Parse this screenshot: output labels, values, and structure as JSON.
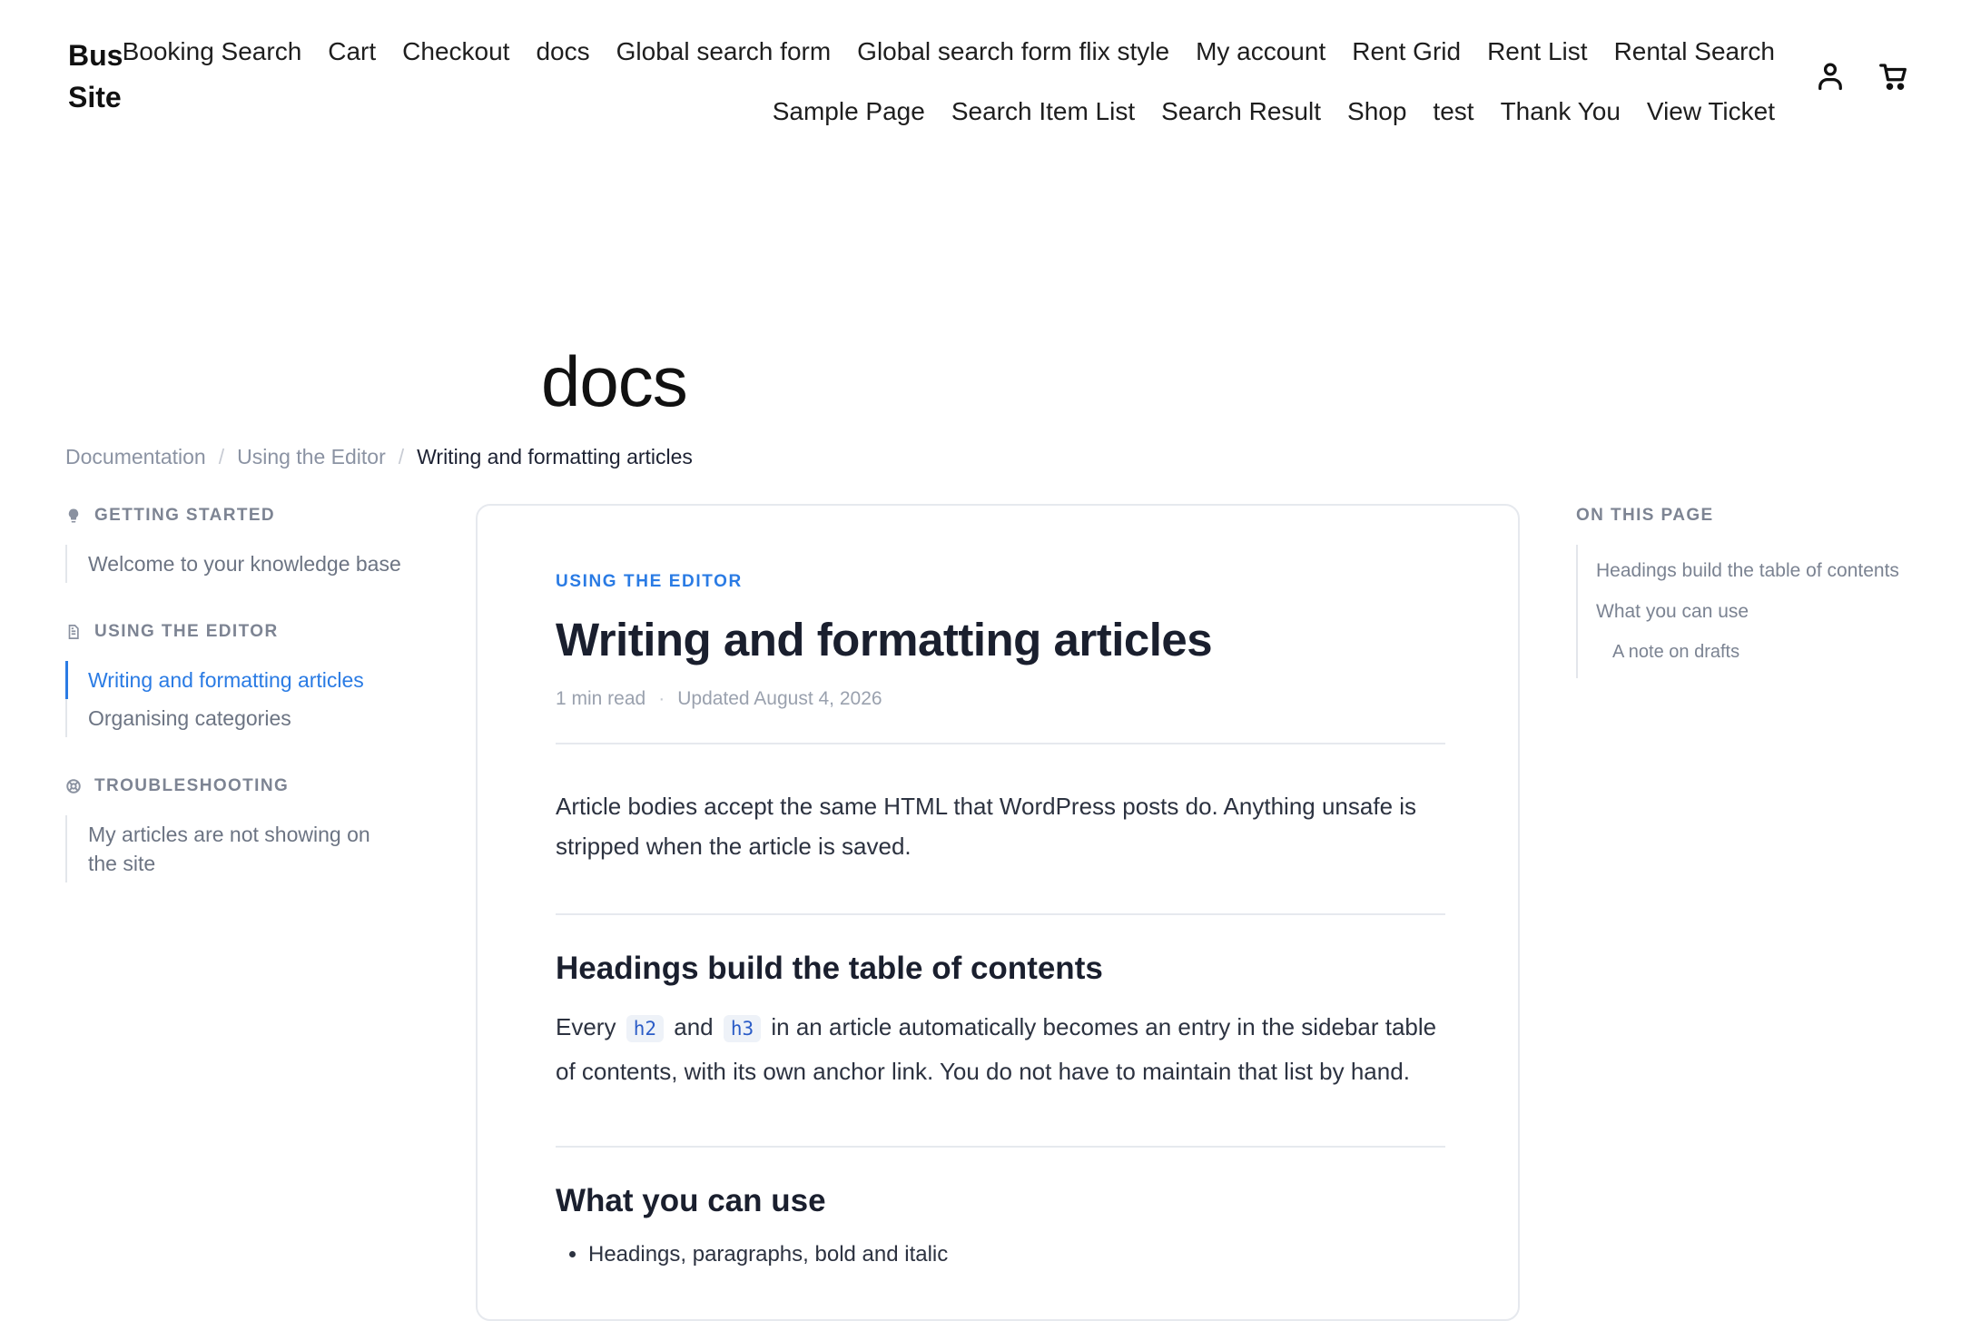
{
  "site": {
    "title": "Bus Site"
  },
  "nav": {
    "row1": [
      "Booking Search",
      "Cart",
      "Checkout",
      "docs",
      "Global search form",
      "Global search form flix style",
      "My account",
      "Rent Grid",
      "Rent List",
      "Rental Search"
    ],
    "row2": [
      "Sample Page",
      "Search Item List",
      "Search Result",
      "Shop",
      "test",
      "Thank You",
      "View Ticket"
    ]
  },
  "icons": {
    "account": "user-icon",
    "cart": "cart-icon"
  },
  "page": {
    "title": "docs"
  },
  "breadcrumb": {
    "items": [
      "Documentation",
      "Using the Editor"
    ],
    "separator": "/",
    "current": "Writing and formatting articles"
  },
  "sidebar": {
    "sections": [
      {
        "icon": "lightbulb-icon",
        "label": "Getting Started",
        "items": [
          "Welcome to your knowledge base"
        ]
      },
      {
        "icon": "document-icon",
        "label": "Using the Editor",
        "items": [
          "Writing and formatting articles",
          "Organising categories"
        ],
        "active_index": 0
      },
      {
        "icon": "lifebuoy-icon",
        "label": "Troubleshooting",
        "items": [
          "My articles are not showing on the site"
        ]
      }
    ]
  },
  "article": {
    "eyebrow": "Using the Editor",
    "title": "Writing and formatting articles",
    "read_time": "1 min read",
    "updated": "Updated August 4, 2026",
    "intro": "Article bodies accept the same HTML that WordPress posts do. Anything unsafe is stripped when the article is saved.",
    "section1": {
      "heading": "Headings build the table of contents",
      "text_a": "Every",
      "code_a": "h2",
      "text_b": "and",
      "code_b": "h3",
      "text_c": "in an article automatically becomes an entry in the sidebar table of contents, with its own anchor link. You do not have to maintain that list by hand."
    },
    "section2": {
      "heading": "What you can use",
      "bullet_1": "Headings, paragraphs, bold and italic"
    }
  },
  "toc": {
    "heading": "On this page",
    "items": [
      {
        "label": "Headings build the table of contents",
        "level": 2
      },
      {
        "label": "What you can use",
        "level": 2
      },
      {
        "label": "A note on drafts",
        "level": 3
      }
    ]
  },
  "colors": {
    "accent": "#2a7be4",
    "text": "#1a1f2e",
    "muted": "#7d8493",
    "border": "#e6e9ee"
  }
}
